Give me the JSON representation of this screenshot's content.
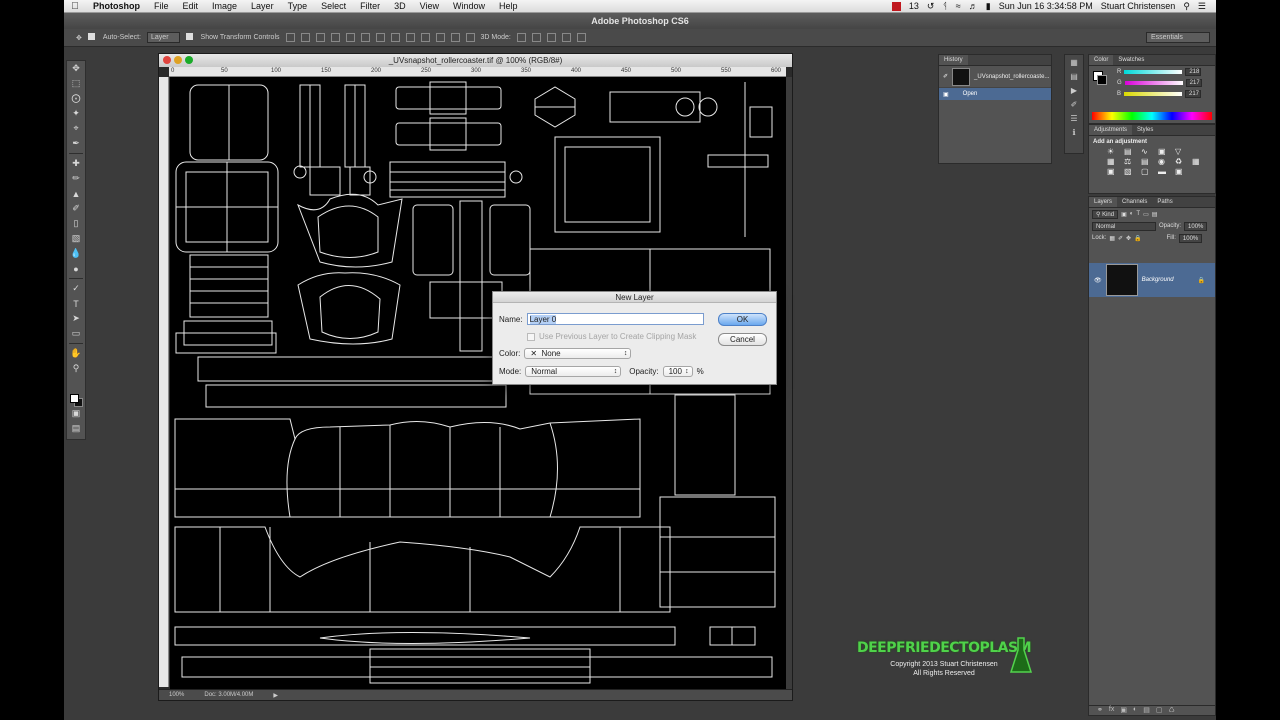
{
  "menubar": {
    "app": "Photoshop",
    "items": [
      "File",
      "Edit",
      "Image",
      "Layer",
      "Type",
      "Select",
      "Filter",
      "3D",
      "View",
      "Window",
      "Help"
    ],
    "adobe_count": "13",
    "clock": "Sun Jun 16  3:34:58 PM",
    "user": "Stuart Christensen"
  },
  "app_title": "Adobe Photoshop CS6",
  "options_bar": {
    "auto_select_label": "Auto-Select:",
    "auto_select_value": "Layer",
    "transform_label": "Show Transform Controls",
    "mode3d_label": "3D Mode:",
    "workspace": "Essentials"
  },
  "document": {
    "title": "_UVsnapshot_rollercoaster.tif @ 100% (RGB/8#)",
    "ruler_ticks": [
      "0",
      "50",
      "100",
      "150",
      "200",
      "250",
      "300",
      "350",
      "400",
      "450",
      "500",
      "550",
      "600"
    ],
    "zoom": "100%",
    "doc_size": "Doc: 3.00M/4.00M"
  },
  "dialog": {
    "title": "New Layer",
    "name_label": "Name:",
    "name_value": "Layer 0",
    "clip_label": "Use Previous Layer to Create Clipping Mask",
    "color_label": "Color:",
    "color_value": "None",
    "mode_label": "Mode:",
    "mode_value": "Normal",
    "opacity_label": "Opacity:",
    "opacity_value": "100",
    "opacity_unit": "%",
    "ok": "OK",
    "cancel": "Cancel"
  },
  "history": {
    "tab": "History",
    "snapshot": "_UVsnapshot_rollercoaste...",
    "state": "Open"
  },
  "color_panel": {
    "tabs": [
      "Color",
      "Swatches"
    ],
    "r_label": "R",
    "r": "218",
    "g_label": "G",
    "g": "217",
    "b_label": "B",
    "b": "217"
  },
  "adjustments": {
    "tabs": [
      "Adjustments",
      "Styles"
    ],
    "heading": "Add an adjustment"
  },
  "layers": {
    "tabs": [
      "Layers",
      "Channels",
      "Paths"
    ],
    "kind": "Kind",
    "blend": "Normal",
    "opacity_label": "Opacity:",
    "opacity": "100%",
    "lock_label": "Lock:",
    "fill_label": "Fill:",
    "fill": "100%",
    "layer_name": "Background"
  },
  "watermark": {
    "logo": "DEEPFRIEDECTOPLASM",
    "copyright": "Copyright 2013  Stuart Christensen",
    "rights": "All Rights Reserved"
  }
}
